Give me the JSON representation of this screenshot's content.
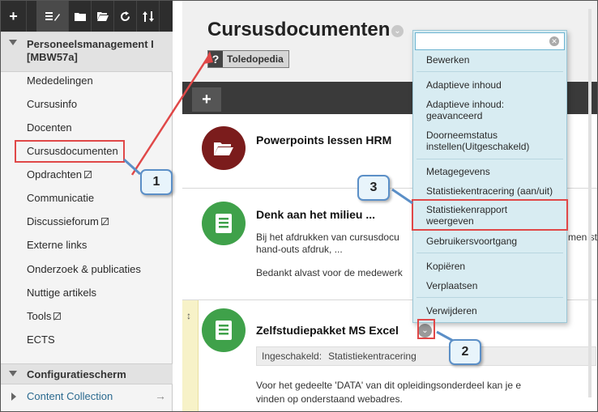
{
  "sidebar": {
    "toolbar": {
      "add_label": "+",
      "reorder_label": "≡✎"
    },
    "course_title": "Personeelsmanagement I [MBW57a]",
    "items": [
      {
        "label": "Mededelingen",
        "hidden": false
      },
      {
        "label": "Cursusinfo",
        "hidden": false
      },
      {
        "label": "Docenten",
        "hidden": false
      },
      {
        "label": "Cursusdocumenten",
        "hidden": false
      },
      {
        "label": "Opdrachten",
        "hidden": true
      },
      {
        "label": "Communicatie",
        "hidden": false
      },
      {
        "label": "Discussieforum",
        "hidden": true
      },
      {
        "label": "Externe links",
        "hidden": false
      },
      {
        "label": "Onderzoek & publicaties",
        "hidden": false
      },
      {
        "label": "Nuttige artikels",
        "hidden": false
      },
      {
        "label": "Tools",
        "hidden": true
      },
      {
        "label": "ECTS",
        "hidden": false
      }
    ],
    "config_title": "Configuratiescherm",
    "collection_label": "Content Collection",
    "collection_arrow": "→"
  },
  "main": {
    "title": "Cursusdocumenten",
    "tag_icon": "?",
    "tag_label": "Toledopedia",
    "add_label": "+",
    "items": [
      {
        "title": "Powerpoints lessen HRM",
        "icon": "folder-icon"
      },
      {
        "title": "Denk aan het milieu ...",
        "icon": "document-icon",
        "lines": [
          "Bij het afdrukken van cursusdocu",
          "hand-outs afdruk, ...",
          "Bedankt alvast voor de medewerk"
        ],
        "lines_cut": [
          "men stil",
          ""
        ]
      },
      {
        "title": "Zelfstudiepakket MS Excel",
        "icon": "document-icon",
        "status_key": "Ingeschakeld:",
        "status_value": "Statistiekentracering",
        "lines": [
          "Voor het gedeelte 'DATA' van dit opleidingsonderdeel kan je e",
          "vinden op onderstaand webadres."
        ]
      }
    ]
  },
  "menu": {
    "search_placeholder": "",
    "groups": [
      [
        "Bewerken"
      ],
      [
        "Adaptieve inhoud",
        "Adaptieve inhoud: geavanceerd",
        "Doorneemstatus instellen(Uitgeschakeld)"
      ],
      [
        "Metagegevens",
        "Statistiekentracering (aan/uit)",
        "Statistiekenrapport weergeven",
        "Gebruikersvoortgang"
      ],
      [
        "Kopiëren",
        "Verplaatsen"
      ],
      [
        "Verwijderen"
      ]
    ],
    "labels": {
      "edit": "Bewerken",
      "adaptive": "Adaptieve inhoud",
      "adaptive_adv_1": "Adaptieve inhoud:",
      "adaptive_adv_2": "geavanceerd",
      "review_1": "Doorneemstatus",
      "review_2": "instellen(Uitgeschakeld)",
      "metadata": "Metagegevens",
      "tracking": "Statistiekentracering (aan/uit)",
      "report_1": "Statistiekenrapport",
      "report_2": "weergeven",
      "progress": "Gebruikersvoortgang",
      "copy": "Kopiëren",
      "move": "Verplaatsen",
      "delete": "Verwijderen"
    }
  },
  "callouts": [
    "1",
    "2",
    "3"
  ],
  "colors": {
    "highlight": "#e04848",
    "callout_border": "#5b8fc7",
    "menu_bg": "#d8ecf2",
    "folder_icon": "#7b1c1c",
    "doc_icon": "#3fa14a"
  }
}
